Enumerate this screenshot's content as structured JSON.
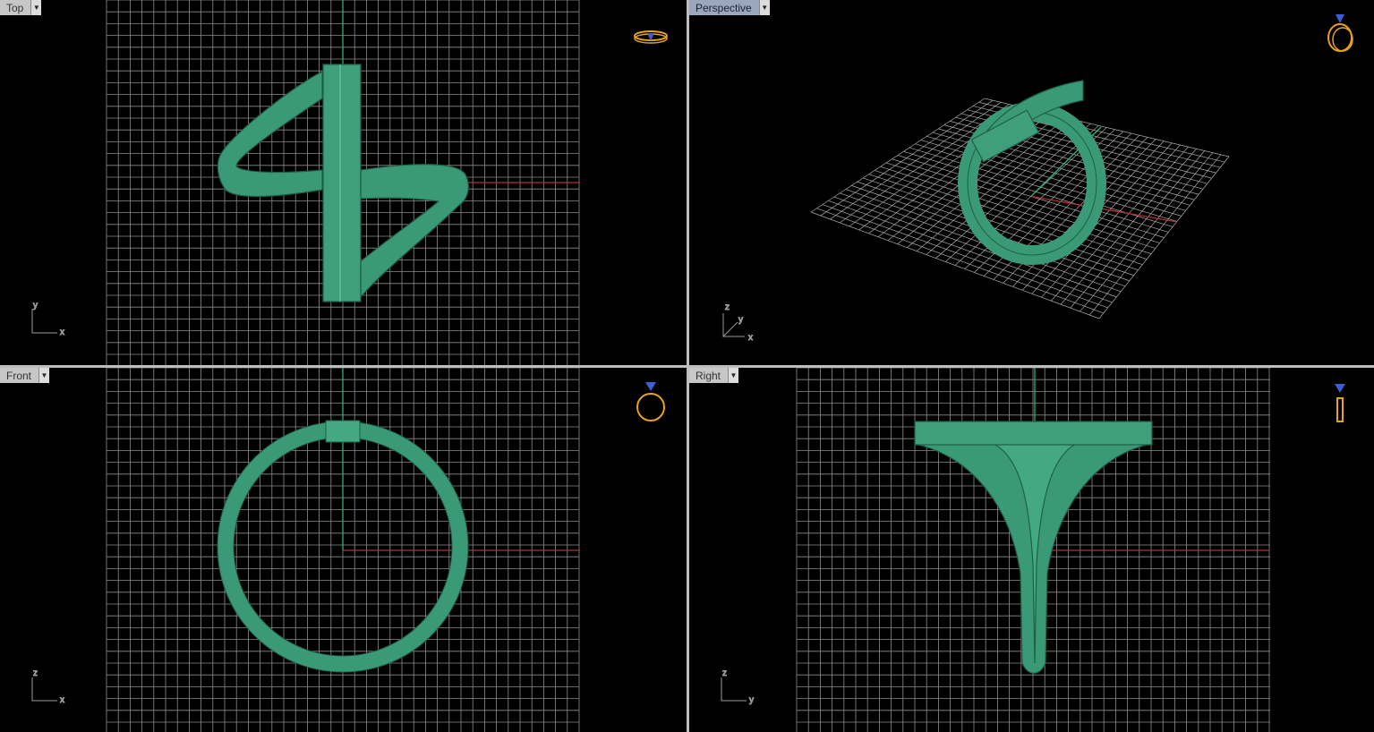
{
  "viewports": [
    {
      "id": "top",
      "label": "Top",
      "active": false,
      "axis_h": "x",
      "axis_v": "y"
    },
    {
      "id": "perspective",
      "label": "Perspective",
      "active": true,
      "axis_h": "x",
      "axis_v": "z",
      "axis_d": "y"
    },
    {
      "id": "front",
      "label": "Front",
      "active": false,
      "axis_h": "x",
      "axis_v": "z"
    },
    {
      "id": "right",
      "label": "Right",
      "active": false,
      "axis_h": "y",
      "axis_v": "z"
    }
  ],
  "icons": {
    "dropdown": "chevron-down-icon",
    "view_cube": "ring-orientation-icon"
  },
  "colors": {
    "background": "#000000",
    "grid": "#8c8c8c",
    "x_axis": "#b0303a",
    "y_axis": "#2fb070",
    "model": "#3a9a78",
    "widget": "#e8a21a",
    "gem": "#3d5fd6"
  }
}
